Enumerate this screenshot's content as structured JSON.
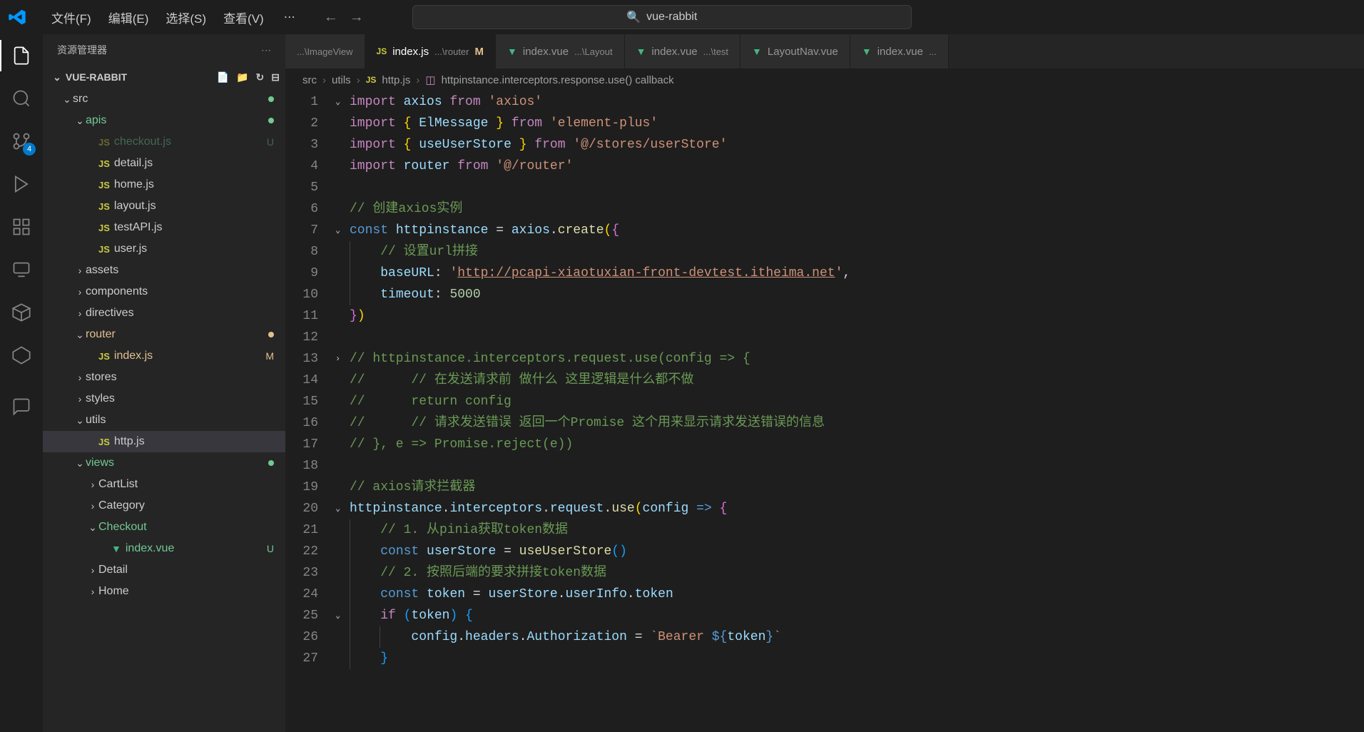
{
  "titleBar": {
    "menus": [
      "文件(F)",
      "编辑(E)",
      "选择(S)",
      "查看(V)"
    ],
    "searchText": "vue-rabbit"
  },
  "activityBar": {
    "scmBadge": "4"
  },
  "sidebar": {
    "title": "资源管理器",
    "folderName": "VUE-RABBIT",
    "tree": [
      {
        "indent": 1,
        "type": "folder",
        "expanded": true,
        "label": "src",
        "decoration": "dot-green"
      },
      {
        "indent": 2,
        "type": "folder",
        "expanded": true,
        "label": "apis",
        "decoration": "dot-green",
        "labelColor": "green"
      },
      {
        "indent": 3,
        "type": "file-js",
        "label": "checkout.js",
        "labelColor": "green",
        "decoration": "U",
        "dim": true
      },
      {
        "indent": 3,
        "type": "file-js",
        "label": "detail.js"
      },
      {
        "indent": 3,
        "type": "file-js",
        "label": "home.js"
      },
      {
        "indent": 3,
        "type": "file-js",
        "label": "layout.js"
      },
      {
        "indent": 3,
        "type": "file-js",
        "label": "testAPI.js"
      },
      {
        "indent": 3,
        "type": "file-js",
        "label": "user.js"
      },
      {
        "indent": 2,
        "type": "folder",
        "expanded": false,
        "label": "assets"
      },
      {
        "indent": 2,
        "type": "folder",
        "expanded": false,
        "label": "components"
      },
      {
        "indent": 2,
        "type": "folder",
        "expanded": false,
        "label": "directives"
      },
      {
        "indent": 2,
        "type": "folder",
        "expanded": true,
        "label": "router",
        "decoration": "dot-orange",
        "labelColor": "orange"
      },
      {
        "indent": 3,
        "type": "file-js",
        "label": "index.js",
        "labelColor": "orange",
        "decoration": "M"
      },
      {
        "indent": 2,
        "type": "folder",
        "expanded": false,
        "label": "stores"
      },
      {
        "indent": 2,
        "type": "folder",
        "expanded": false,
        "label": "styles"
      },
      {
        "indent": 2,
        "type": "folder",
        "expanded": true,
        "label": "utils"
      },
      {
        "indent": 3,
        "type": "file-js",
        "label": "http.js",
        "selected": true
      },
      {
        "indent": 2,
        "type": "folder",
        "expanded": true,
        "label": "views",
        "decoration": "dot-green",
        "labelColor": "green"
      },
      {
        "indent": 3,
        "type": "folder",
        "expanded": false,
        "label": "CartList"
      },
      {
        "indent": 3,
        "type": "folder",
        "expanded": false,
        "label": "Category"
      },
      {
        "indent": 3,
        "type": "folder",
        "expanded": true,
        "label": "Checkout",
        "labelColor": "green"
      },
      {
        "indent": 4,
        "type": "file-vue",
        "label": "index.vue",
        "labelColor": "green",
        "decoration": "U"
      },
      {
        "indent": 3,
        "type": "folder",
        "expanded": false,
        "label": "Detail"
      },
      {
        "indent": 3,
        "type": "folder",
        "expanded": false,
        "label": "Home"
      }
    ]
  },
  "tabs": [
    {
      "icon": "none",
      "label": "",
      "path": "...\\ImageView"
    },
    {
      "icon": "js",
      "label": "index.js",
      "path": "...\\router",
      "mod": "M",
      "active": true
    },
    {
      "icon": "vue",
      "label": "index.vue",
      "path": "...\\Layout"
    },
    {
      "icon": "vue",
      "label": "index.vue",
      "path": "...\\test"
    },
    {
      "icon": "vue",
      "label": "LayoutNav.vue",
      "path": ""
    },
    {
      "icon": "vue",
      "label": "index.vue",
      "path": "..."
    }
  ],
  "breadcrumbs": {
    "parts": [
      "src",
      "utils"
    ],
    "file": "http.js",
    "symbol": "httpinstance.interceptors.response.use() callback"
  },
  "code": {
    "lines": [
      {
        "n": 1,
        "fold": "v",
        "segs": [
          [
            "kw-purple",
            "import"
          ],
          [
            "punct",
            " "
          ],
          [
            "var-ltblue",
            "axios"
          ],
          [
            "punct",
            " "
          ],
          [
            "kw-purple",
            "from"
          ],
          [
            "punct",
            " "
          ],
          [
            "str",
            "'axios'"
          ]
        ]
      },
      {
        "n": 2,
        "segs": [
          [
            "kw-purple",
            "import"
          ],
          [
            "punct",
            " "
          ],
          [
            "brace-yellow",
            "{"
          ],
          [
            "punct",
            " "
          ],
          [
            "var-ltblue",
            "ElMessage"
          ],
          [
            "punct",
            " "
          ],
          [
            "brace-yellow",
            "}"
          ],
          [
            "punct",
            " "
          ],
          [
            "kw-purple",
            "from"
          ],
          [
            "punct",
            " "
          ],
          [
            "str",
            "'element-plus'"
          ]
        ]
      },
      {
        "n": 3,
        "segs": [
          [
            "kw-purple",
            "import"
          ],
          [
            "punct",
            " "
          ],
          [
            "brace-yellow",
            "{"
          ],
          [
            "punct",
            " "
          ],
          [
            "var-ltblue",
            "useUserStore"
          ],
          [
            "punct",
            " "
          ],
          [
            "brace-yellow",
            "}"
          ],
          [
            "punct",
            " "
          ],
          [
            "kw-purple",
            "from"
          ],
          [
            "punct",
            " "
          ],
          [
            "str",
            "'@/stores/userStore'"
          ]
        ]
      },
      {
        "n": 4,
        "segs": [
          [
            "kw-purple",
            "import"
          ],
          [
            "punct",
            " "
          ],
          [
            "var-ltblue",
            "router"
          ],
          [
            "punct",
            " "
          ],
          [
            "kw-purple",
            "from"
          ],
          [
            "punct",
            " "
          ],
          [
            "str",
            "'@/router'"
          ]
        ]
      },
      {
        "n": 5,
        "segs": []
      },
      {
        "n": 6,
        "segs": [
          [
            "comment",
            "// 创建axios实例"
          ]
        ]
      },
      {
        "n": 7,
        "fold": "v",
        "segs": [
          [
            "kw-blue",
            "const"
          ],
          [
            "punct",
            " "
          ],
          [
            "var-ltblue",
            "httpinstance"
          ],
          [
            "punct",
            " = "
          ],
          [
            "var-ltblue",
            "axios"
          ],
          [
            "punct",
            "."
          ],
          [
            "fn-yellow",
            "create"
          ],
          [
            "brace-yellow",
            "("
          ],
          [
            "brace-pink",
            "{"
          ]
        ]
      },
      {
        "n": 8,
        "indent": 1,
        "segs": [
          [
            "punct",
            "    "
          ],
          [
            "comment",
            "// 设置url拼接"
          ]
        ]
      },
      {
        "n": 9,
        "indent": 1,
        "segs": [
          [
            "punct",
            "    "
          ],
          [
            "var-ltblue",
            "baseURL"
          ],
          [
            "punct",
            ": "
          ],
          [
            "str",
            "'"
          ],
          [
            "str url-link",
            "http://pcapi-xiaotuxian-front-devtest.itheima.net"
          ],
          [
            "str",
            "'"
          ],
          [
            "punct",
            ","
          ]
        ]
      },
      {
        "n": 10,
        "indent": 1,
        "segs": [
          [
            "punct",
            "    "
          ],
          [
            "var-ltblue",
            "timeout"
          ],
          [
            "punct",
            ": "
          ],
          [
            "num",
            "5000"
          ]
        ]
      },
      {
        "n": 11,
        "segs": [
          [
            "brace-pink",
            "}"
          ],
          [
            "brace-yellow",
            ")"
          ]
        ]
      },
      {
        "n": 12,
        "segs": []
      },
      {
        "n": 13,
        "fold": ">",
        "segs": [
          [
            "comment",
            "// httpinstance.interceptors.request.use(config => {"
          ]
        ]
      },
      {
        "n": 14,
        "segs": [
          [
            "comment",
            "//      // 在发送请求前 做什么 这里逻辑是什么都不做"
          ]
        ]
      },
      {
        "n": 15,
        "segs": [
          [
            "comment",
            "//      return config"
          ]
        ]
      },
      {
        "n": 16,
        "segs": [
          [
            "comment",
            "//      // 请求发送错误 返回一个Promise 这个用来显示请求发送错误的信息"
          ]
        ]
      },
      {
        "n": 17,
        "segs": [
          [
            "comment",
            "// }, e => Promise.reject(e))"
          ]
        ]
      },
      {
        "n": 18,
        "segs": []
      },
      {
        "n": 19,
        "segs": [
          [
            "comment",
            "// axios请求拦截器"
          ]
        ]
      },
      {
        "n": 20,
        "fold": "v",
        "segs": [
          [
            "var-ltblue",
            "httpinstance"
          ],
          [
            "punct",
            "."
          ],
          [
            "var-ltblue",
            "interceptors"
          ],
          [
            "punct",
            "."
          ],
          [
            "var-ltblue",
            "request"
          ],
          [
            "punct",
            "."
          ],
          [
            "fn-yellow",
            "use"
          ],
          [
            "brace-yellow",
            "("
          ],
          [
            "var-ltblue",
            "config"
          ],
          [
            "punct",
            " "
          ],
          [
            "kw-blue",
            "=>"
          ],
          [
            "punct",
            " "
          ],
          [
            "brace-pink",
            "{"
          ]
        ]
      },
      {
        "n": 21,
        "indent": 1,
        "segs": [
          [
            "punct",
            "    "
          ],
          [
            "comment",
            "// 1. 从pinia获取token数据"
          ]
        ]
      },
      {
        "n": 22,
        "indent": 1,
        "segs": [
          [
            "punct",
            "    "
          ],
          [
            "kw-blue",
            "const"
          ],
          [
            "punct",
            " "
          ],
          [
            "var-ltblue",
            "userStore"
          ],
          [
            "punct",
            " = "
          ],
          [
            "fn-yellow",
            "useUserStore"
          ],
          [
            "brace-blue",
            "()"
          ]
        ]
      },
      {
        "n": 23,
        "indent": 1,
        "segs": [
          [
            "punct",
            "    "
          ],
          [
            "comment",
            "// 2. 按照后端的要求拼接token数据"
          ]
        ]
      },
      {
        "n": 24,
        "indent": 1,
        "segs": [
          [
            "punct",
            "    "
          ],
          [
            "kw-blue",
            "const"
          ],
          [
            "punct",
            " "
          ],
          [
            "var-ltblue",
            "token"
          ],
          [
            "punct",
            " = "
          ],
          [
            "var-ltblue",
            "userStore"
          ],
          [
            "punct",
            "."
          ],
          [
            "var-ltblue",
            "userInfo"
          ],
          [
            "punct",
            "."
          ],
          [
            "var-ltblue",
            "token"
          ]
        ]
      },
      {
        "n": 25,
        "fold": "v",
        "indent": 1,
        "segs": [
          [
            "punct",
            "    "
          ],
          [
            "kw-purple",
            "if"
          ],
          [
            "punct",
            " "
          ],
          [
            "brace-blue",
            "("
          ],
          [
            "var-ltblue",
            "token"
          ],
          [
            "brace-blue",
            ")"
          ],
          [
            "punct",
            " "
          ],
          [
            "brace-blue",
            "{"
          ]
        ]
      },
      {
        "n": 26,
        "indent": 2,
        "segs": [
          [
            "punct",
            "        "
          ],
          [
            "var-ltblue",
            "config"
          ],
          [
            "punct",
            "."
          ],
          [
            "var-ltblue",
            "headers"
          ],
          [
            "punct",
            "."
          ],
          [
            "var-ltblue",
            "Authorization"
          ],
          [
            "punct",
            " = "
          ],
          [
            "str",
            "`Bearer "
          ],
          [
            "kw-blue",
            "${"
          ],
          [
            "var-ltblue",
            "token"
          ],
          [
            "kw-blue",
            "}"
          ],
          [
            "str",
            "`"
          ]
        ]
      },
      {
        "n": 27,
        "indent": 1,
        "segs": [
          [
            "punct",
            "    "
          ],
          [
            "brace-blue",
            "}"
          ]
        ]
      }
    ]
  }
}
